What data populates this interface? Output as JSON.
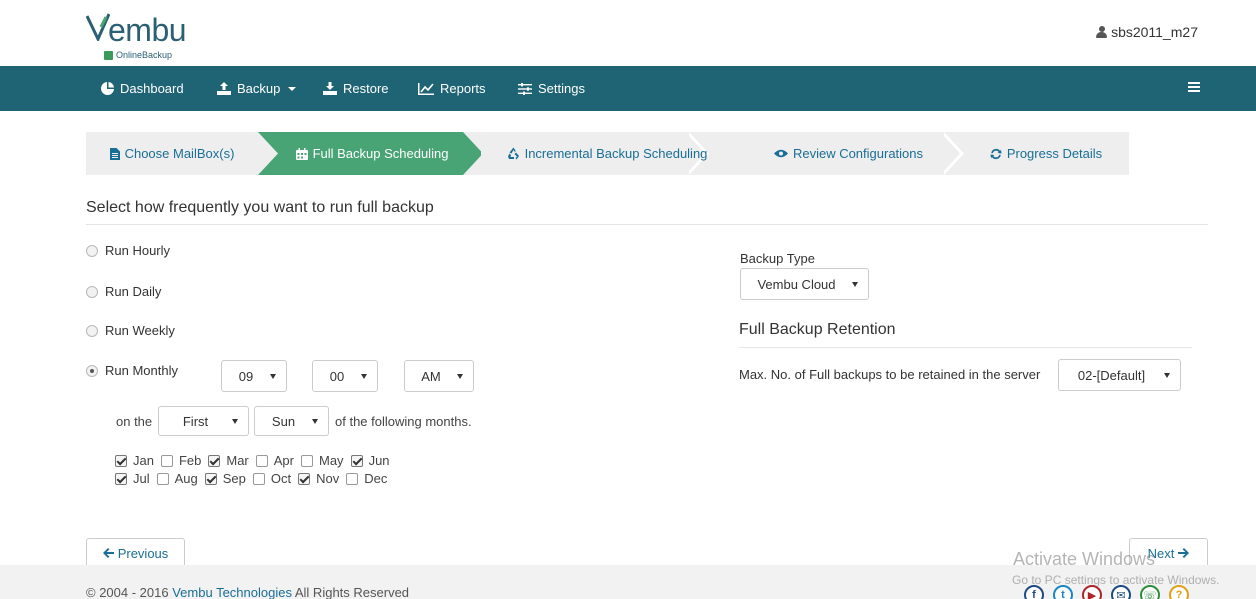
{
  "brand": {
    "name": "embu",
    "sub": "OnlineBackup",
    "accent": "#1f6475",
    "green": "#48a474"
  },
  "user": {
    "name": "sbs2011_m27",
    "icon": "user-icon"
  },
  "nav": {
    "items": [
      {
        "label": "Dashboard",
        "icon": "dashboard-icon"
      },
      {
        "label": "Backup",
        "icon": "upload-icon",
        "dropdown": true
      },
      {
        "label": "Restore",
        "icon": "download-icon"
      },
      {
        "label": "Reports",
        "icon": "chart-icon"
      },
      {
        "label": "Settings",
        "icon": "sliders-icon"
      }
    ],
    "menu_icon": "hamburger-icon"
  },
  "wizard": {
    "steps": [
      {
        "label": "Choose MailBox(s)",
        "icon": "document-icon",
        "active": false
      },
      {
        "label": "Full Backup Scheduling",
        "icon": "calendar-icon",
        "active": true
      },
      {
        "label": "Incremental Backup Scheduling",
        "icon": "recycle-icon",
        "active": false
      },
      {
        "label": "Review Configurations",
        "icon": "eye-icon",
        "active": false
      },
      {
        "label": "Progress Details",
        "icon": "refresh-icon",
        "active": false
      }
    ]
  },
  "schedule": {
    "title": "Select how frequently you want to run full backup",
    "options": [
      {
        "label": "Run Hourly",
        "selected": false
      },
      {
        "label": "Run Daily",
        "selected": false
      },
      {
        "label": "Run Weekly",
        "selected": false
      },
      {
        "label": "Run Monthly",
        "selected": true
      }
    ],
    "hour": "09",
    "minute": "00",
    "ampm": "AM",
    "on_the_label": "on the",
    "week": "First",
    "day": "Sun",
    "following_label": "of the following months.",
    "months": [
      {
        "label": "Jan",
        "checked": true
      },
      {
        "label": "Feb",
        "checked": false
      },
      {
        "label": "Mar",
        "checked": true
      },
      {
        "label": "Apr",
        "checked": false
      },
      {
        "label": "May",
        "checked": false
      },
      {
        "label": "Jun",
        "checked": true
      },
      {
        "label": "Jul",
        "checked": true
      },
      {
        "label": "Aug",
        "checked": false
      },
      {
        "label": "Sep",
        "checked": true
      },
      {
        "label": "Oct",
        "checked": false
      },
      {
        "label": "Nov",
        "checked": true
      },
      {
        "label": "Dec",
        "checked": false
      }
    ]
  },
  "backup_type": {
    "label": "Backup Type",
    "value": "Vembu Cloud"
  },
  "retention": {
    "title": "Full Backup Retention",
    "label": "Max. No. of Full backups to be retained in the server",
    "value": "02-[Default]"
  },
  "buttons": {
    "previous": "Previous",
    "next": "Next"
  },
  "footer": {
    "copyright_prefix": "© 2004 - 2016",
    "company": "Vembu Technologies",
    "copyright_suffix": "All Rights Reserved",
    "social": [
      "facebook-icon",
      "twitter-icon",
      "youtube-icon",
      "email-icon",
      "phone-icon",
      "help-icon"
    ]
  },
  "watermark": {
    "line1": "Activate Windows",
    "line2": "Go to PC settings to activate Windows."
  }
}
